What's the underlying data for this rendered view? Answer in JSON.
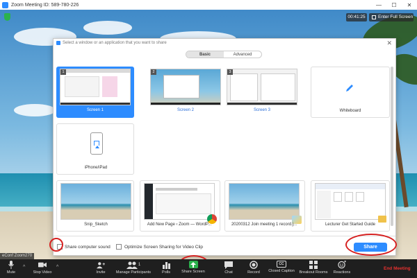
{
  "window": {
    "title": "Zoom Meeting ID: 589-780-226",
    "minimize": "—",
    "maximize": "☐",
    "close": "✕"
  },
  "meeting_overlay": {
    "timer": "00:41:25",
    "fullscreen_label": "Enter Full Screen"
  },
  "dialog": {
    "header": "Select a window or an application that you want to share",
    "tabs": [
      {
        "label": "Basic",
        "active": true
      },
      {
        "label": "Advanced",
        "active": false
      }
    ],
    "tiles": [
      {
        "num": "1",
        "label": "Screen 1",
        "selected": true
      },
      {
        "num": "2",
        "label": "Screen 2"
      },
      {
        "num": "3",
        "label": "Screen 3"
      },
      {
        "label": "Whiteboard"
      },
      {
        "label": "iPhone/iPad"
      },
      {
        "label": "Snip_Sketch"
      },
      {
        "label": "Add New Page ‹ Zoom — WordP..."
      },
      {
        "label": "20200312 Join meeting 1 record.j..."
      },
      {
        "label": "Lecturer Get Started Guide"
      }
    ],
    "footer": {
      "share_sound": "Share computer sound",
      "optimize": "Optimize Screen Sharing for Video Clip",
      "share_button": "Share"
    }
  },
  "participant_label": "eConf Zoom270",
  "toolbar": {
    "mute": "Mute",
    "stop_video": "Stop Video",
    "invite": "Invite",
    "manage_participants": "Manage Participants",
    "participant_count": "1",
    "polls": "Polls",
    "share_screen": "Share Screen",
    "chat": "Chat",
    "record": "Record",
    "closed_caption": "Closed Caption",
    "cc_badge": "CC",
    "breakout_rooms": "Breakout Rooms",
    "reactions": "Reactions",
    "end_meeting": "End Meeting"
  },
  "colors": {
    "accent": "#2d8cff",
    "end_meeting": "#e8312f",
    "share_green": "#2bb24c",
    "highlight_ring": "#d62020"
  }
}
